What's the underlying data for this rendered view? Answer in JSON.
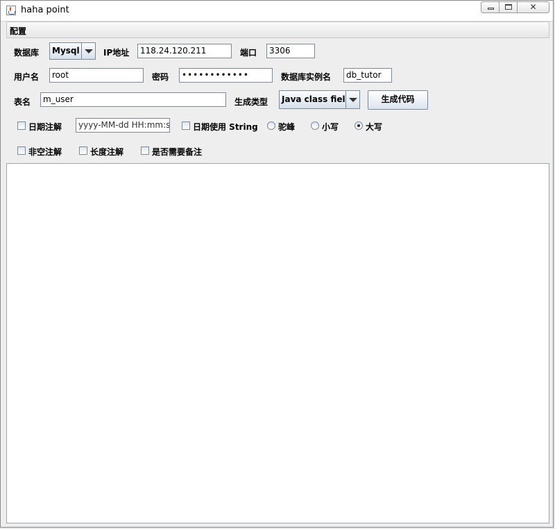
{
  "window": {
    "title": "haha point"
  },
  "menu": {
    "config_label": "配置"
  },
  "form": {
    "db_label": "数据库",
    "db_value": "Mysql",
    "ip_label": "IP地址",
    "ip_value": "118.24.120.211",
    "port_label": "端口",
    "port_value": "3306",
    "user_label": "用户名",
    "user_value": "root",
    "password_label": "密码",
    "password_value": "••••••••••••",
    "instance_label": "数据库实例名",
    "instance_value": "db_tutor",
    "table_label": "表名",
    "table_value": "m_user",
    "gen_type_label": "生成类型",
    "gen_type_value": "Java class field",
    "generate_button": "生成代码"
  },
  "options": {
    "date_annotation": {
      "label": "日期注解",
      "checked": false
    },
    "date_format_value": "yyyy-MM-dd HH:mm:ss",
    "date_use_string": {
      "label": "日期使用 String",
      "checked": false
    },
    "radio_camel": {
      "label": "驼峰",
      "selected": false
    },
    "radio_lower": {
      "label": "小写",
      "selected": false
    },
    "radio_upper": {
      "label": "大写",
      "selected": true
    },
    "not_null_annotation": {
      "label": "非空注解",
      "checked": false
    },
    "length_annotation": {
      "label": "长度注解",
      "checked": false
    },
    "need_remark": {
      "label": "是否需要备注",
      "checked": false
    }
  },
  "output": {
    "text": ""
  }
}
